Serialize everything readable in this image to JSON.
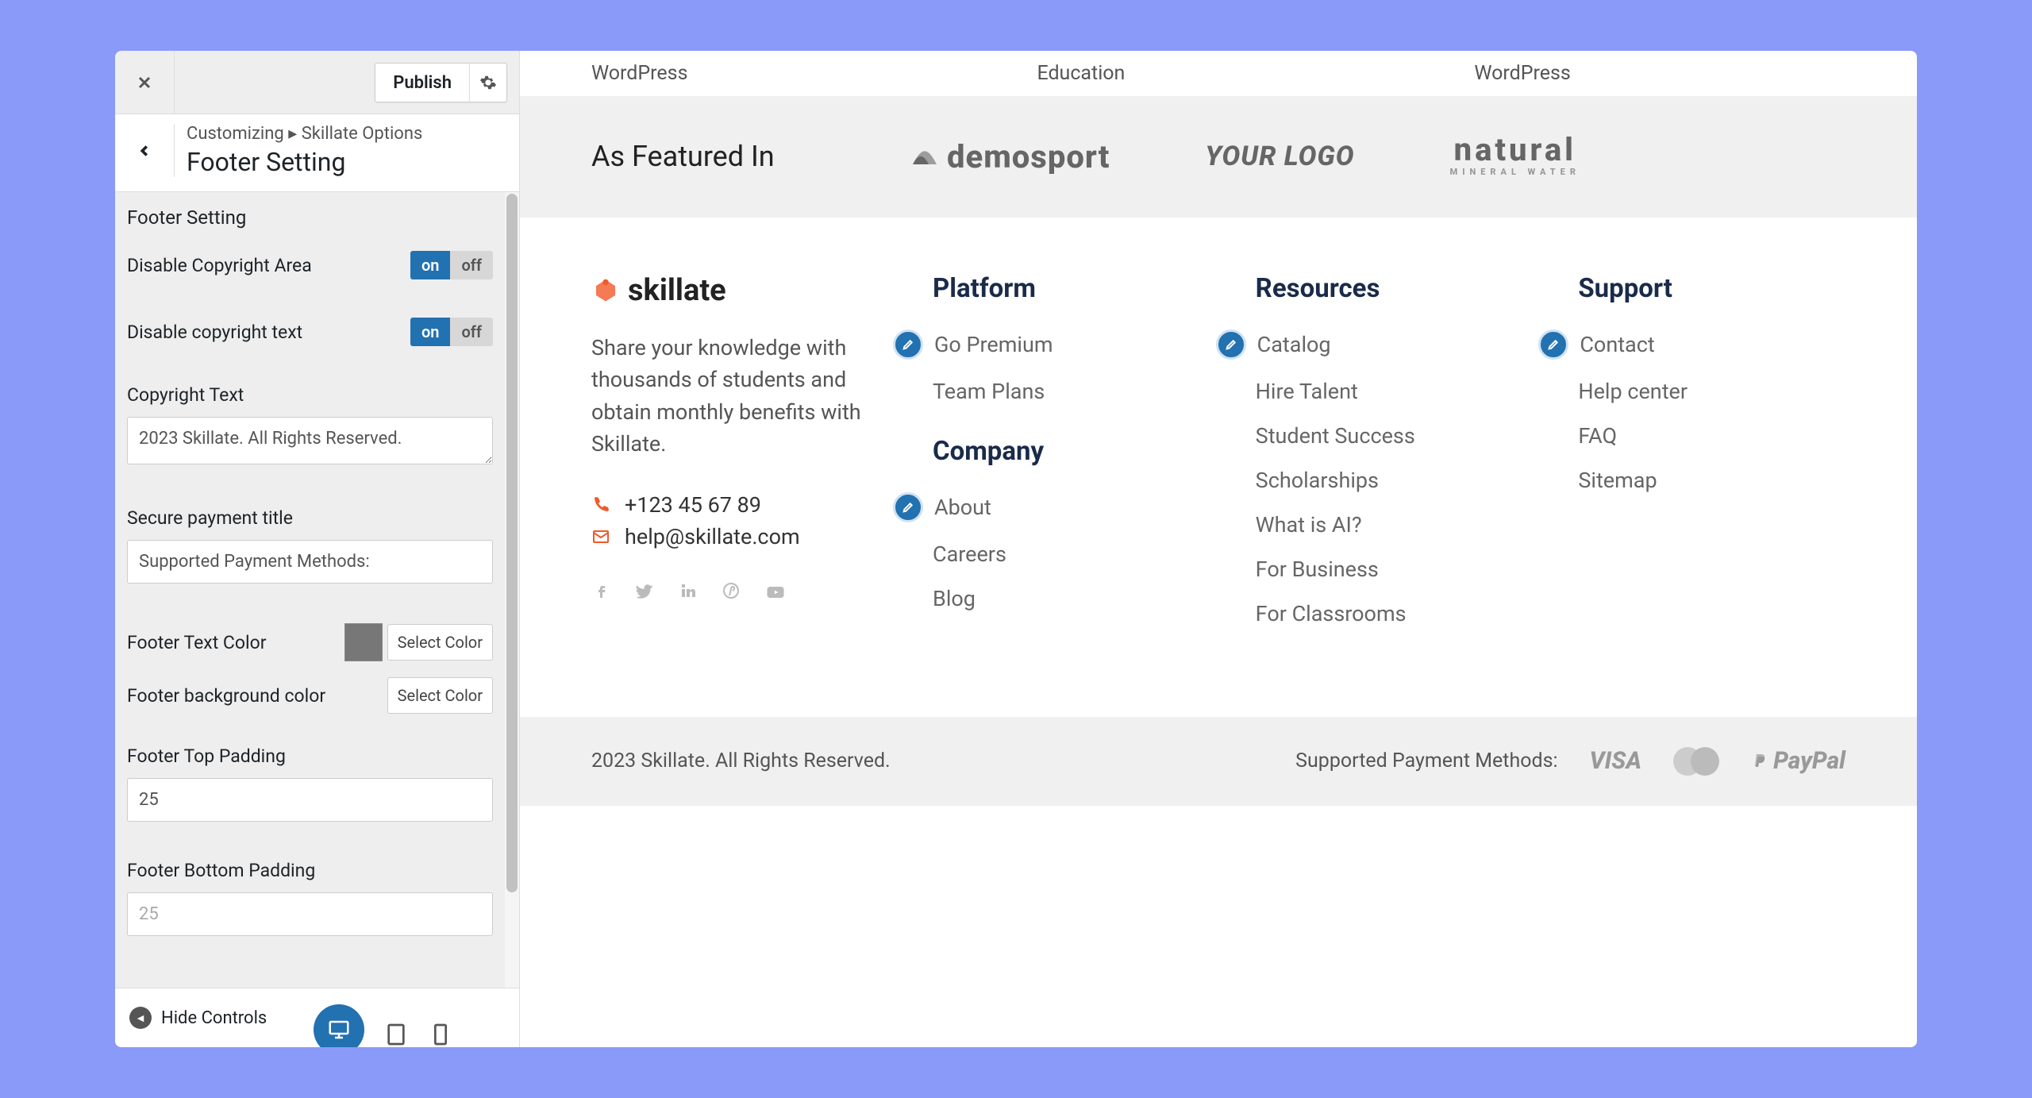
{
  "sidebar": {
    "publish_label": "Publish",
    "breadcrumb_prefix": "Customizing ▸",
    "breadcrumb_section": "Skillate Options",
    "breadcrumb_title": "Footer Setting",
    "section_title": "Footer Setting",
    "disable_copyright_area": {
      "label": "Disable Copyright Area",
      "on": "on",
      "off": "off"
    },
    "disable_copyright_text": {
      "label": "Disable copyright text",
      "on": "on",
      "off": "off"
    },
    "copyright_text": {
      "label": "Copyright Text",
      "value": "2023 Skillate. All Rights Reserved."
    },
    "secure_payment": {
      "label": "Secure payment title",
      "value": "Supported Payment Methods:"
    },
    "footer_text_color": {
      "label": "Footer Text Color",
      "btn": "Select Color",
      "swatch": "#777777"
    },
    "footer_bg_color": {
      "label": "Footer background color",
      "btn": "Select Color"
    },
    "footer_top_padding": {
      "label": "Footer Top Padding",
      "value": "25"
    },
    "footer_bottom_padding": {
      "label": "Footer Bottom Padding",
      "value": "25"
    },
    "hide_controls": "Hide Controls"
  },
  "preview": {
    "tags": [
      "WordPress",
      "Education",
      "WordPress"
    ],
    "featured_in": "As Featured In",
    "brand1": "demosport",
    "brand2": "YOUR LOGO",
    "brand3": "natural",
    "brand3_sub": "MINERAL WATER",
    "logo_text": "skillate",
    "about_text": "Share your knowledge with thousands of students and obtain monthly benefits with Skillate.",
    "phone": "+123 45 67 89",
    "email": "help@skillate.com",
    "columns": {
      "platform": {
        "heading": "Platform",
        "links": [
          "Go Premium",
          "Team Plans"
        ]
      },
      "company": {
        "heading": "Company",
        "links": [
          "About",
          "Careers",
          "Blog"
        ]
      },
      "resources": {
        "heading": "Resources",
        "links": [
          "Catalog",
          "Hire Talent",
          "Student Success",
          "Scholarships",
          "What is AI?",
          "For Business",
          "For Classrooms"
        ]
      },
      "support": {
        "heading": "Support",
        "links": [
          "Contact",
          "Help center",
          "FAQ",
          "Sitemap"
        ]
      }
    },
    "copyright": "2023 Skillate. All Rights Reserved.",
    "payment_title": "Supported Payment Methods:",
    "pay_visa": "VISA",
    "pay_paypal": "PayPal"
  }
}
